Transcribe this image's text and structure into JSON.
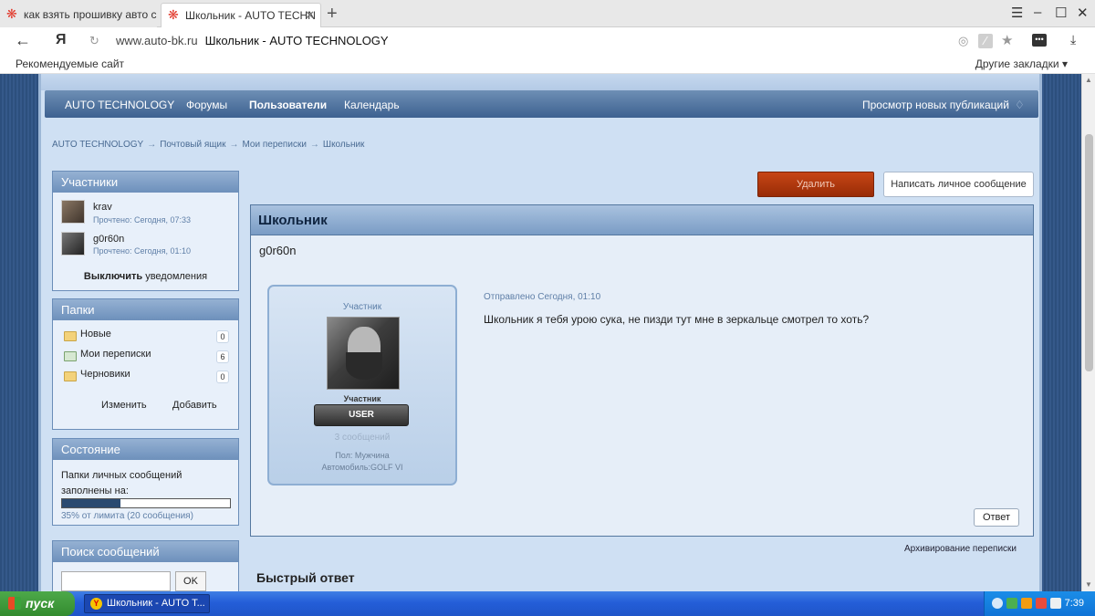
{
  "browser": {
    "tabs": [
      {
        "label": "как взять прошивку авто с",
        "active": false
      },
      {
        "label": "Школьник - AUTO TECHN",
        "active": true
      }
    ],
    "new_tab": "+",
    "address_domain": "www.auto-bk.ru",
    "address_title": "Школьник - AUTO TECHNOLOGY",
    "yandex_button": "Я",
    "bookmarks_left": "Рекомендуемые сайт",
    "bookmarks_right": "Другие закладки ▾"
  },
  "nav": {
    "items": [
      "AUTO TECHNOLOGY",
      "Форумы",
      "Пользователи",
      "Календарь"
    ],
    "right": "Просмотр новых публикаций"
  },
  "breadcrumb": {
    "items": [
      "AUTO TECHNOLOGY",
      "Почтовый ящик",
      "Мои переписки",
      "Школьник"
    ],
    "separator": "→"
  },
  "participants": {
    "title": "Участники",
    "users": [
      {
        "name": "krav",
        "status": "Прочтено: Сегодня, 07:33"
      },
      {
        "name": "g0r60n",
        "status": "Прочтено: Сегодня, 01:10"
      }
    ],
    "notify_bold": "Выключить",
    "notify_rest": " уведомления"
  },
  "folders": {
    "title": "Папки",
    "items": [
      {
        "label": "Новые",
        "count": "0"
      },
      {
        "label": "Мои переписки",
        "count": "6"
      },
      {
        "label": "Черновики",
        "count": "0"
      }
    ],
    "edit": "Изменить",
    "add": "Добавить"
  },
  "state": {
    "title": "Состояние",
    "line1": "Папки личных сообщений",
    "line2": "заполнены на:",
    "usage_fraction": 0.35,
    "usage_text": "35% от лимита (20 сообщения)"
  },
  "search": {
    "title": "Поиск сообщений",
    "input_value": "",
    "ok": "OK"
  },
  "actions": {
    "delete": "Удалить",
    "compose": "Написать личное сообщение"
  },
  "conversation": {
    "title": "Школьник",
    "subtitle": "g0r60n",
    "author": {
      "role": "Участник",
      "group_title": "Участник",
      "badge": "USER",
      "posts": "3 сообщений",
      "gender": "Пол: Мужчина",
      "car": "Автомобиль:GOLF VI"
    },
    "sent": "Отправлено Сегодня, 01:10",
    "text": "Школьник я тебя урою сука, не пизди тут мне в зеркальце смотрел то хоть?",
    "reply": "Ответ"
  },
  "archive": "Архивирование переписки",
  "quick_reply": "Быстрый ответ",
  "taskbar": {
    "start": "пуск",
    "task": "Школьник - AUTO T...",
    "task_icon": "Y",
    "clock": "7:39"
  }
}
